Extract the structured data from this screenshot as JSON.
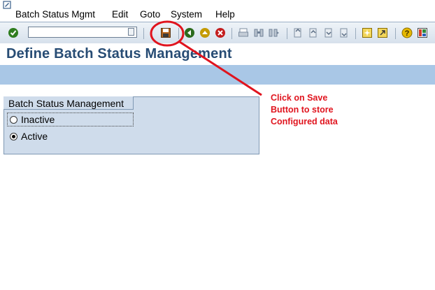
{
  "menubar": {
    "items": [
      "Batch Status Mgmt",
      "Edit",
      "Goto",
      "System",
      "Help"
    ]
  },
  "toolbar": {
    "command_value": "",
    "icons": [
      "enter-icon",
      "save-icon",
      "back-icon",
      "exit-icon",
      "cancel-icon",
      "print-icon",
      "find-icon",
      "find-next-icon",
      "first-page-icon",
      "previous-page-icon",
      "next-page-icon",
      "last-page-icon",
      "create-session-icon",
      "shortcut-icon",
      "help-icon",
      "layout-icon"
    ]
  },
  "page": {
    "title": "Define Batch Status Management"
  },
  "group": {
    "title": "Batch Status Management",
    "options": [
      {
        "label": "Inactive",
        "selected": false
      },
      {
        "label": "Active",
        "selected": true
      }
    ]
  },
  "annotation": {
    "lines": [
      "Click on Save",
      "Button to store",
      "Configured data"
    ],
    "color": "#e0141e"
  },
  "colors": {
    "title": "#274c74",
    "appbar": "#a9c7e6",
    "groupbox": "#cfdceb"
  }
}
